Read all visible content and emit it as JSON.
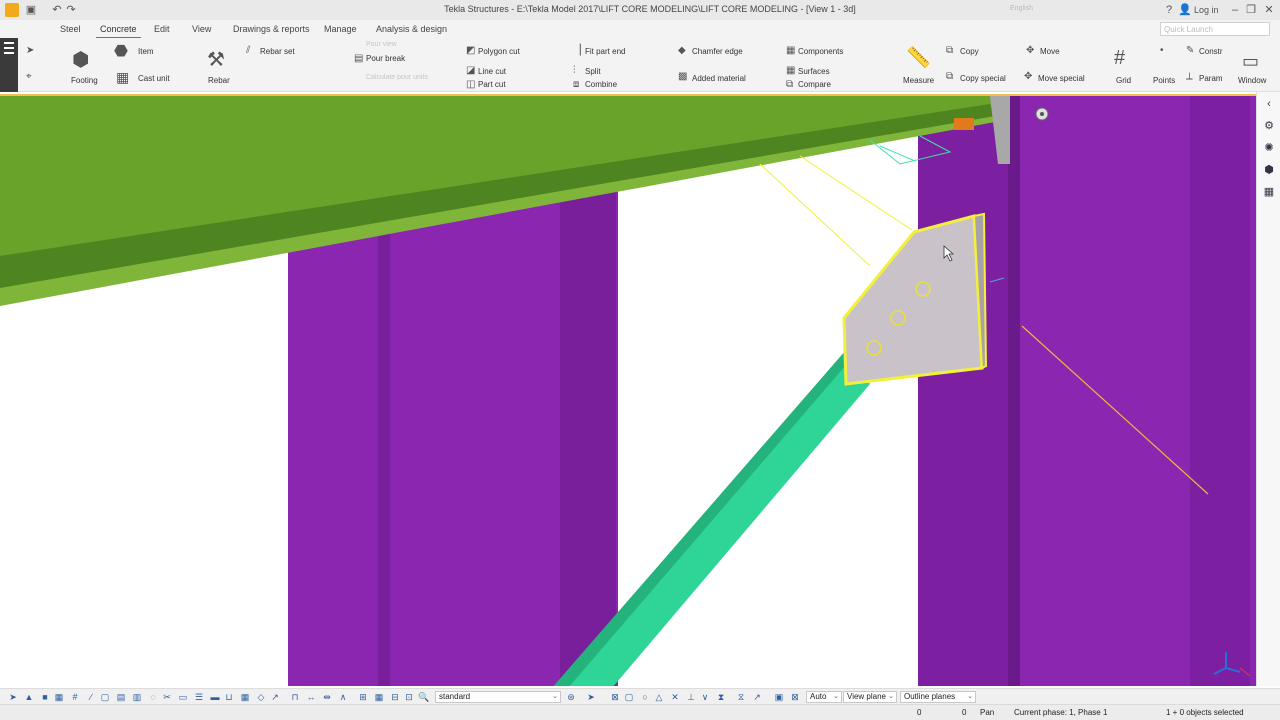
{
  "window": {
    "title": "Tekla Structures - E:\\Tekla Model 2017\\LIFT CORE MODELING\\LIFT CORE MODELING - [View 1 - 3d]",
    "language": "English",
    "login_label": "Log in",
    "quick_launch_placeholder": "Quick Launch"
  },
  "menu": {
    "tabs": [
      "Steel",
      "Concrete",
      "Edit",
      "View",
      "Drawings & reports",
      "Manage",
      "Analysis & design"
    ],
    "active_tab": "Concrete"
  },
  "ribbon": {
    "footing": "Footing",
    "item": "Item",
    "cast_unit": "Cast unit",
    "rebar": "Rebar",
    "rebar_set": "Rebar set",
    "pour_view": "Pour view",
    "pour_break": "Pour break",
    "calculate_pour_units": "Calculate pour units",
    "polygon_cut": "Polygon cut",
    "line_cut": "Line cut",
    "part_cut": "Part cut",
    "fit_part_end": "Fit part end",
    "split": "Split",
    "combine": "Combine",
    "chamfer_edge": "Chamfer edge",
    "added_material": "Added material",
    "components": "Components",
    "surfaces": "Surfaces",
    "compare": "Compare",
    "measure": "Measure",
    "copy": "Copy",
    "copy_special": "Copy special",
    "move": "Move",
    "move_special": "Move special",
    "grid": "Grid",
    "points": "Points",
    "construction": "Constr",
    "parametric": "Param",
    "window": "Window"
  },
  "bottom_toolbar": {
    "filter_value": "standard",
    "snap_mode": "Auto",
    "plane_mode": "View plane",
    "outline_mode": "Outline planes"
  },
  "status": {
    "coord_x": "0",
    "coord_y": "0",
    "mode": "Pan",
    "current_phase": "Current phase: 1, Phase 1",
    "selection": "1 + 0 objects selected"
  },
  "colors": {
    "beam_green": "#6aa32a",
    "column_purple": "#8b26b0",
    "brace_teal": "#2fd596",
    "plate_gray": "#c9c3c9",
    "highlight_yellow": "#f2f03a",
    "accent_blue": "#3a7bd5"
  }
}
